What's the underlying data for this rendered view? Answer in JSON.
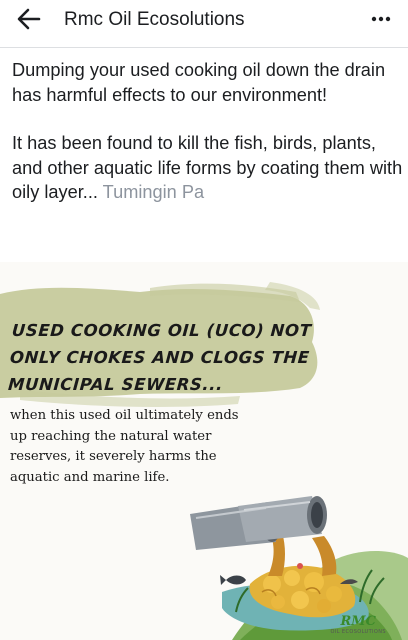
{
  "header": {
    "title": "Rmc Oil Ecosolutions",
    "back_icon": "arrow-left-icon",
    "more_icon": "more-horizontal-icon"
  },
  "post": {
    "paragraph1": "Dumping your used cooking oil down the drain has harmful effects to our environment!",
    "paragraph2_text": "It has been found to kill the fish, birds, plants, and other aquatic life forms by coating them with oily layer... ",
    "see_more_label": "Tumingin Pa"
  },
  "graphic": {
    "headline_line1": "USED COOKING OIL (UCO) NOT",
    "headline_line2": "ONLY CHOKES AND CLOGS THE",
    "headline_line3": "MUNICIPAL SEWERS...",
    "body_line1": "when this used oil ultimately ends",
    "body_line2": "up reaching the natural water",
    "body_line3": "reserves, it severely harms the",
    "body_line4": "aquatic and marine life.",
    "brand_name": "RMC",
    "brand_sub": "OIL ECOSOLUTIONS",
    "colors": {
      "brush_green": "#c6ca9c",
      "oil_yellow": "#e2b23a",
      "water_green": "#5f9a3a",
      "pipe_grey": "#8e969e"
    }
  }
}
